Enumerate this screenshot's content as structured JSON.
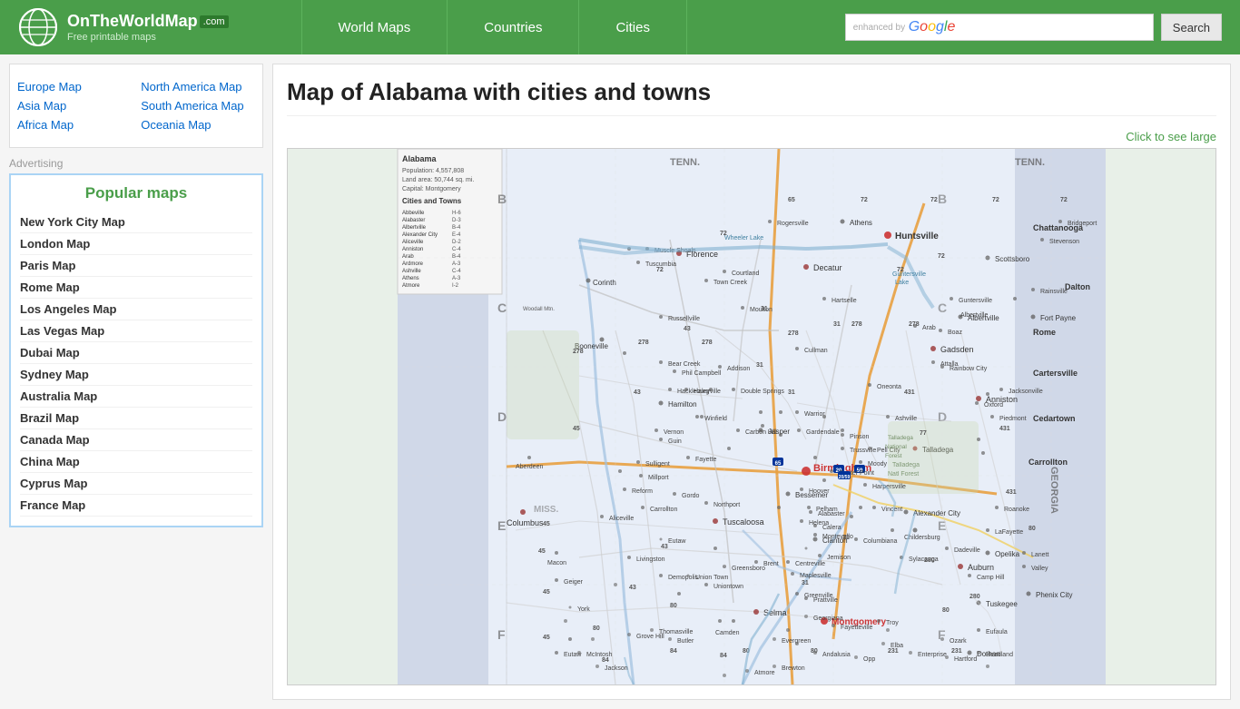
{
  "header": {
    "logo_title": "OnTheWorldMap",
    "logo_dotcom": ".com",
    "logo_subtitle": "Free printable maps",
    "nav_items": [
      {
        "label": "World Maps",
        "id": "world-maps"
      },
      {
        "label": "Countries",
        "id": "countries"
      },
      {
        "label": "Cities",
        "id": "cities"
      }
    ],
    "search_button_label": "Search",
    "search_placeholder": "",
    "enhanced_by": "enhanced by",
    "google_label": "Google"
  },
  "sidebar": {
    "nav_left": [
      {
        "label": "Europe Map"
      },
      {
        "label": "Asia Map"
      },
      {
        "label": "Africa Map"
      }
    ],
    "nav_right": [
      {
        "label": "North America Map"
      },
      {
        "label": "South America Map"
      },
      {
        "label": "Oceania Map"
      }
    ],
    "advertising_label": "Advertising",
    "popular_maps_title": "Popular maps",
    "popular_map_links": [
      "New York City Map",
      "London Map",
      "Paris Map",
      "Rome Map",
      "Los Angeles Map",
      "Las Vegas Map",
      "Dubai Map",
      "Sydney Map",
      "Australia Map",
      "Brazil Map",
      "Canada Map",
      "China Map",
      "Cyprus Map",
      "France Map"
    ]
  },
  "content": {
    "page_title": "Map of Alabama with cities and towns",
    "click_to_large": "Click to see large",
    "map_alt": "Map of Alabama with cities and towns"
  },
  "icons": {
    "logo_globe": "globe-icon",
    "search": "search-icon"
  }
}
